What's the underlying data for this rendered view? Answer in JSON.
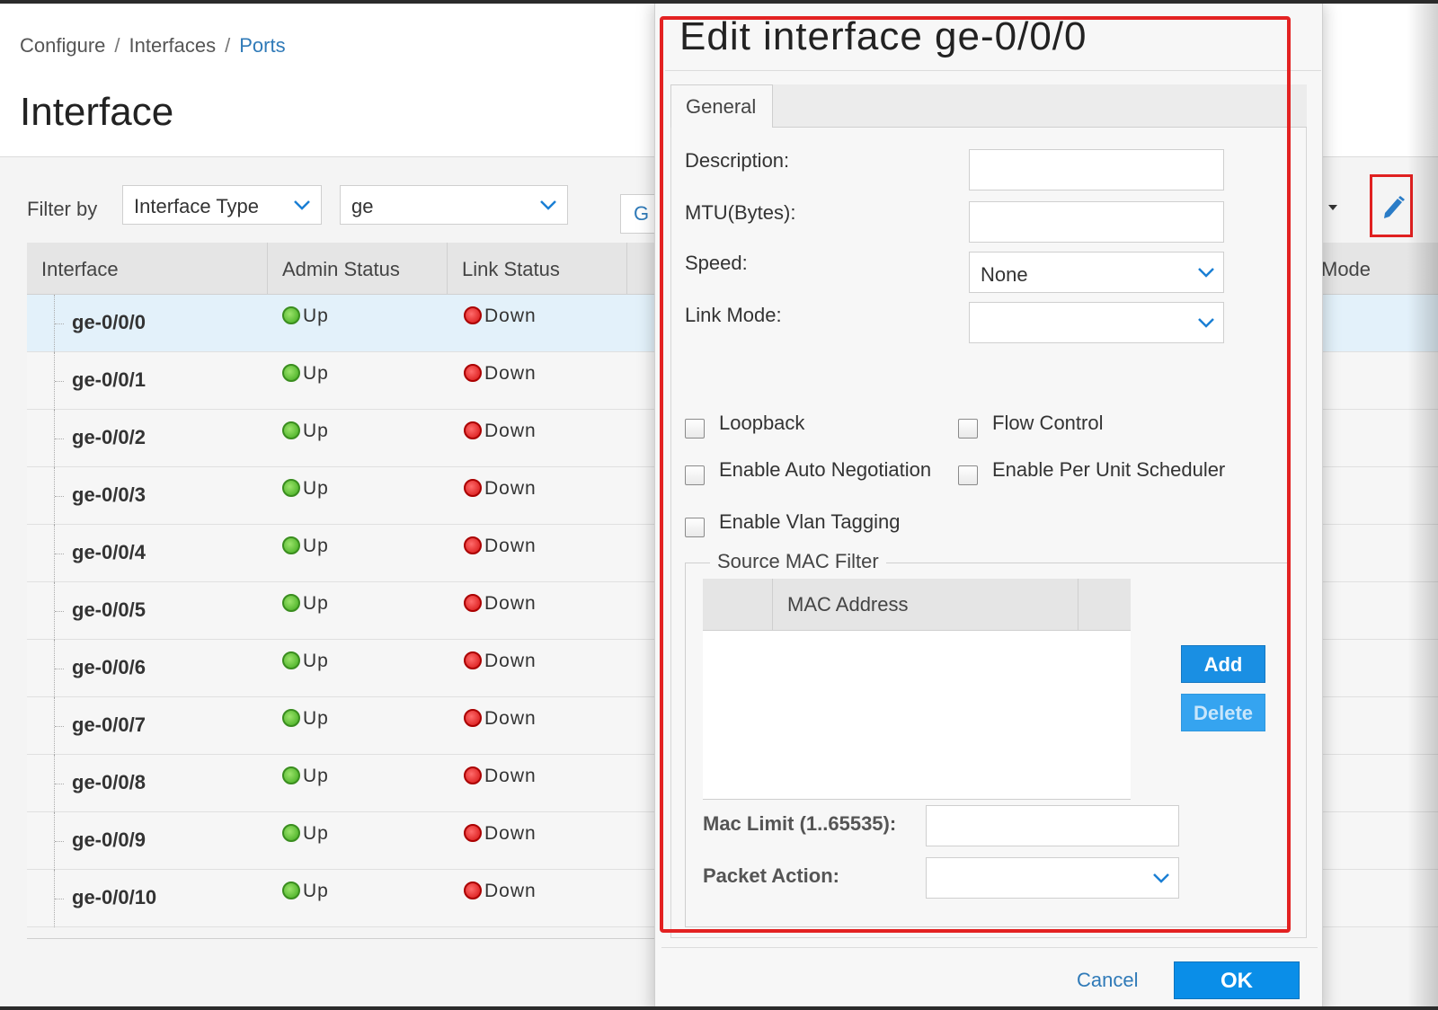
{
  "breadcrumb": {
    "items": [
      "Configure",
      "Interfaces",
      "Ports"
    ],
    "separator": "/"
  },
  "page_title": "Interface",
  "filter": {
    "label": "Filter by",
    "type_select": "Interface Type",
    "value_select": "ge",
    "go_label": "G"
  },
  "grid": {
    "columns": [
      "Interface",
      "Admin Status",
      "Link Status"
    ],
    "extra_column": "Mode",
    "rows": [
      {
        "interface": "ge-0/0/0",
        "admin": "Up",
        "link": "Down"
      },
      {
        "interface": "ge-0/0/1",
        "admin": "Up",
        "link": "Down"
      },
      {
        "interface": "ge-0/0/2",
        "admin": "Up",
        "link": "Down"
      },
      {
        "interface": "ge-0/0/3",
        "admin": "Up",
        "link": "Down"
      },
      {
        "interface": "ge-0/0/4",
        "admin": "Up",
        "link": "Down"
      },
      {
        "interface": "ge-0/0/5",
        "admin": "Up",
        "link": "Down"
      },
      {
        "interface": "ge-0/0/6",
        "admin": "Up",
        "link": "Down"
      },
      {
        "interface": "ge-0/0/7",
        "admin": "Up",
        "link": "Down"
      },
      {
        "interface": "ge-0/0/8",
        "admin": "Up",
        "link": "Down"
      },
      {
        "interface": "ge-0/0/9",
        "admin": "Up",
        "link": "Down"
      },
      {
        "interface": "ge-0/0/10",
        "admin": "Up",
        "link": "Down"
      }
    ]
  },
  "modal": {
    "title": "Edit interface ge-0/0/0",
    "tab": "General",
    "fields": {
      "description_label": "Description:",
      "description_value": "",
      "mtu_label": "MTU(Bytes):",
      "mtu_value": "",
      "speed_label": "Speed:",
      "speed_value": "None",
      "link_mode_label": "Link Mode:",
      "link_mode_value": ""
    },
    "checkboxes": {
      "loopback": "Loopback",
      "flow_control": "Flow Control",
      "auto_negotiation": "Enable Auto Negotiation",
      "per_unit_scheduler": "Enable Per Unit Scheduler",
      "vlan_tagging": "Enable Vlan Tagging"
    },
    "mac_filter": {
      "legend": "Source MAC Filter",
      "column": "MAC Address",
      "add_label": "Add",
      "delete_label": "Delete",
      "mac_limit_label": "Mac Limit (1..65535):",
      "mac_limit_value": "",
      "packet_action_label": "Packet Action:",
      "packet_action_value": ""
    },
    "cancel_label": "Cancel",
    "ok_label": "OK"
  },
  "colors": {
    "accent_blue": "#1a8fe3",
    "highlight_red": "#e32222",
    "status_up": "#3faa1c",
    "status_down": "#d41010"
  },
  "icons": [
    "chevron-down-icon",
    "pencil-icon",
    "status-up-icon",
    "status-down-icon",
    "caret-down-icon"
  ]
}
